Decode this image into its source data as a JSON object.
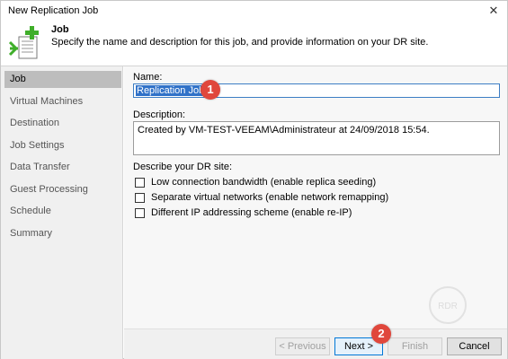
{
  "window": {
    "title": "New Replication Job",
    "close_glyph": "✕"
  },
  "header": {
    "title": "Job",
    "description": "Specify the name and description for this job, and provide information on your DR site.",
    "icon": "new-job-icon",
    "accent_color": "#3fae2a"
  },
  "sidebar": {
    "items": [
      {
        "label": "Job",
        "active": true
      },
      {
        "label": "Virtual Machines"
      },
      {
        "label": "Destination"
      },
      {
        "label": "Job Settings"
      },
      {
        "label": "Data Transfer"
      },
      {
        "label": "Guest Processing"
      },
      {
        "label": "Schedule"
      },
      {
        "label": "Summary"
      }
    ]
  },
  "form": {
    "name_label": "Name:",
    "name_value": "Replication Job 1",
    "description_label": "Description:",
    "description_value": "Created by VM-TEST-VEEAM\\Administrateur at 24/09/2018 15:54.",
    "dr_site_label": "Describe your DR site:",
    "options": [
      {
        "label": "Low connection bandwidth (enable replica seeding)",
        "checked": false
      },
      {
        "label": "Separate virtual networks (enable network remapping)",
        "checked": false
      },
      {
        "label": "Different IP addressing scheme (enable re-IP)",
        "checked": false
      }
    ]
  },
  "footer": {
    "previous_label": "< Previous",
    "next_label": "Next >",
    "finish_label": "Finish",
    "cancel_label": "Cancel"
  },
  "callouts": {
    "first": "1",
    "second": "2",
    "color": "#e0473c"
  },
  "watermark": {
    "text": "RDR"
  }
}
